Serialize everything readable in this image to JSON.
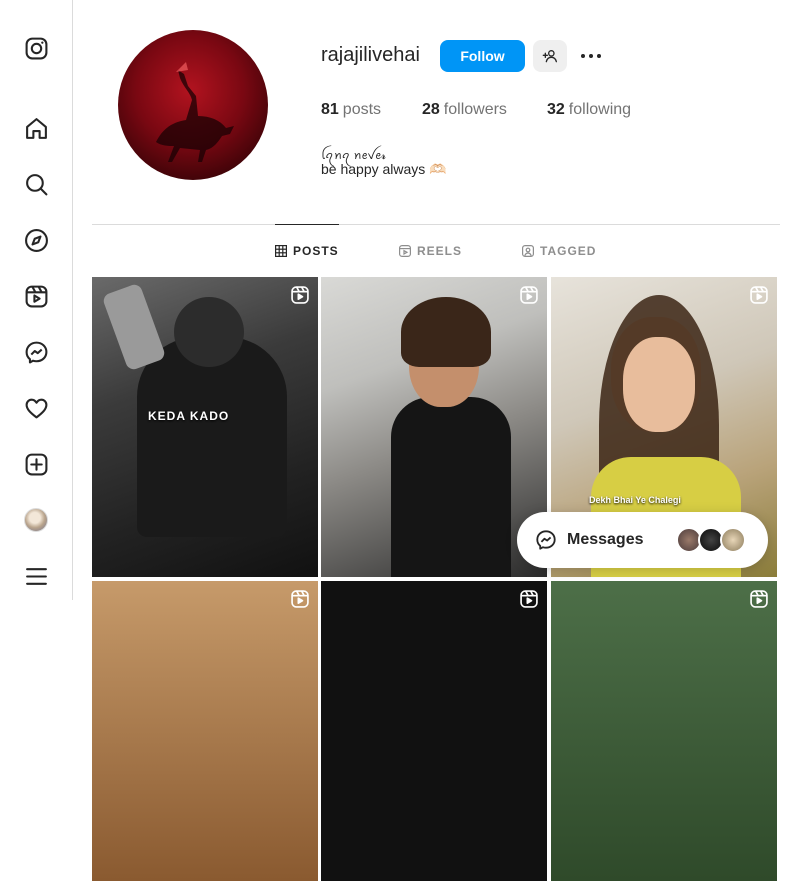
{
  "sidebar": {
    "items": [
      {
        "name": "instagram-logo-icon",
        "label": "Instagram"
      },
      {
        "name": "home-icon",
        "label": "Home"
      },
      {
        "name": "search-icon",
        "label": "Search"
      },
      {
        "name": "explore-icon",
        "label": "Explore"
      },
      {
        "name": "reels-icon",
        "label": "Reels"
      },
      {
        "name": "messenger-icon",
        "label": "Messages"
      },
      {
        "name": "heart-icon",
        "label": "Notifications"
      },
      {
        "name": "create-icon",
        "label": "Create"
      },
      {
        "name": "profile-avatar",
        "label": "Profile"
      },
      {
        "name": "menu-icon",
        "label": "More"
      }
    ]
  },
  "profile": {
    "username": "rajajilivehai",
    "follow_label": "Follow",
    "stats": {
      "posts_count": "81",
      "posts_label": "posts",
      "followers_count": "28",
      "followers_label": "followers",
      "following_count": "32",
      "following_label": "following"
    },
    "bio_name": "ꪶꪖꪀꪖ ꪀꫀꪜꫀ𝓻",
    "bio_text": "be happy always 🫶🏻"
  },
  "tabs": [
    {
      "label": "POSTS",
      "active": true
    },
    {
      "label": "REELS",
      "active": false
    },
    {
      "label": "TAGGED",
      "active": false
    }
  ],
  "grid": {
    "tiles": [
      {
        "caption": "KEDA KADO"
      },
      {
        "caption": ""
      },
      {
        "caption": "Dekh Bhai Ye Chalegi"
      }
    ]
  },
  "messages_bubble": {
    "label": "Messages"
  },
  "colors": {
    "accent": "#0095f6",
    "border": "#dbdbdb",
    "text": "#262626",
    "muted": "#737373"
  }
}
